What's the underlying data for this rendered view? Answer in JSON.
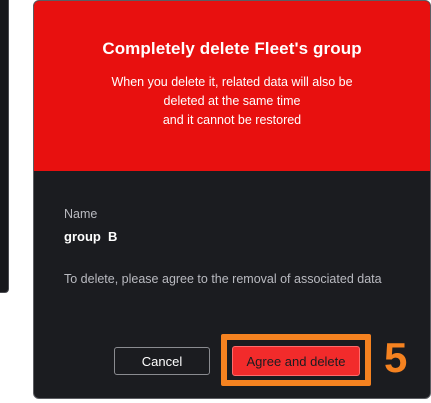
{
  "dialog": {
    "title": "Completely delete Fleet's group",
    "message_lines": [
      "When you delete it, related data will also be",
      "deleted at the same time",
      "and it cannot be restored"
    ],
    "name_label": "Name",
    "name_value": "group  B",
    "agree_text": "To delete, please agree to the removal of associated data",
    "cancel_label": "Cancel",
    "agree_label": "Agree and delete"
  },
  "annotation": {
    "step": "5"
  },
  "colors": {
    "header": "#e8100f",
    "dialog_bg": "#1b1c20",
    "highlight": "#f58220",
    "danger_button": "#f22b2b"
  }
}
